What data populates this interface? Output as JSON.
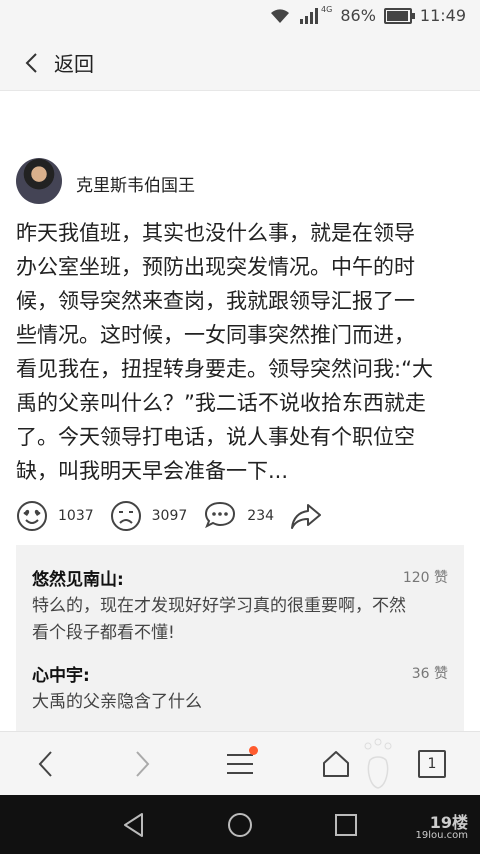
{
  "status": {
    "battery": "86%",
    "time": "11:49",
    "network": "4G"
  },
  "nav": {
    "back_label": "返回"
  },
  "post": {
    "author": "克里斯韦伯国王",
    "lines": [
      "昨天我值班，其实也没什么事，就是在领导",
      "办公室坐班，预防出现突发情况。中午的时",
      "候，领导突然来查岗，我就跟领导汇报了一",
      "些情况。这时候，一女同事突然推门而进，",
      "看见我在，扭捏转身要走。领导突然问我:“大",
      "禹的父亲叫什么？”我二话不说收拾东西就走",
      "了。今天领导打电话，说人事处有个职位空",
      "缺，叫我明天早会准备一下..."
    ]
  },
  "reactions": {
    "love": "1037",
    "sad": "3097",
    "comment": "234"
  },
  "comments": [
    {
      "name": "悠然见南山:",
      "likes": "120 赞",
      "text_lines": [
        "特么的，现在才发现好好学习真的很重要啊，不然",
        "看个段子都看不懂!"
      ]
    },
    {
      "name": "心中宇:",
      "likes": "36 赞",
      "text_lines": [
        "大禹的父亲隐含了什么"
      ]
    }
  ],
  "toolbar": {
    "tabs_count": "1"
  },
  "watermark": {
    "brand": "19楼",
    "site": "19lou.com"
  },
  "colors": {
    "notification_dot": "#ff5b2e"
  }
}
